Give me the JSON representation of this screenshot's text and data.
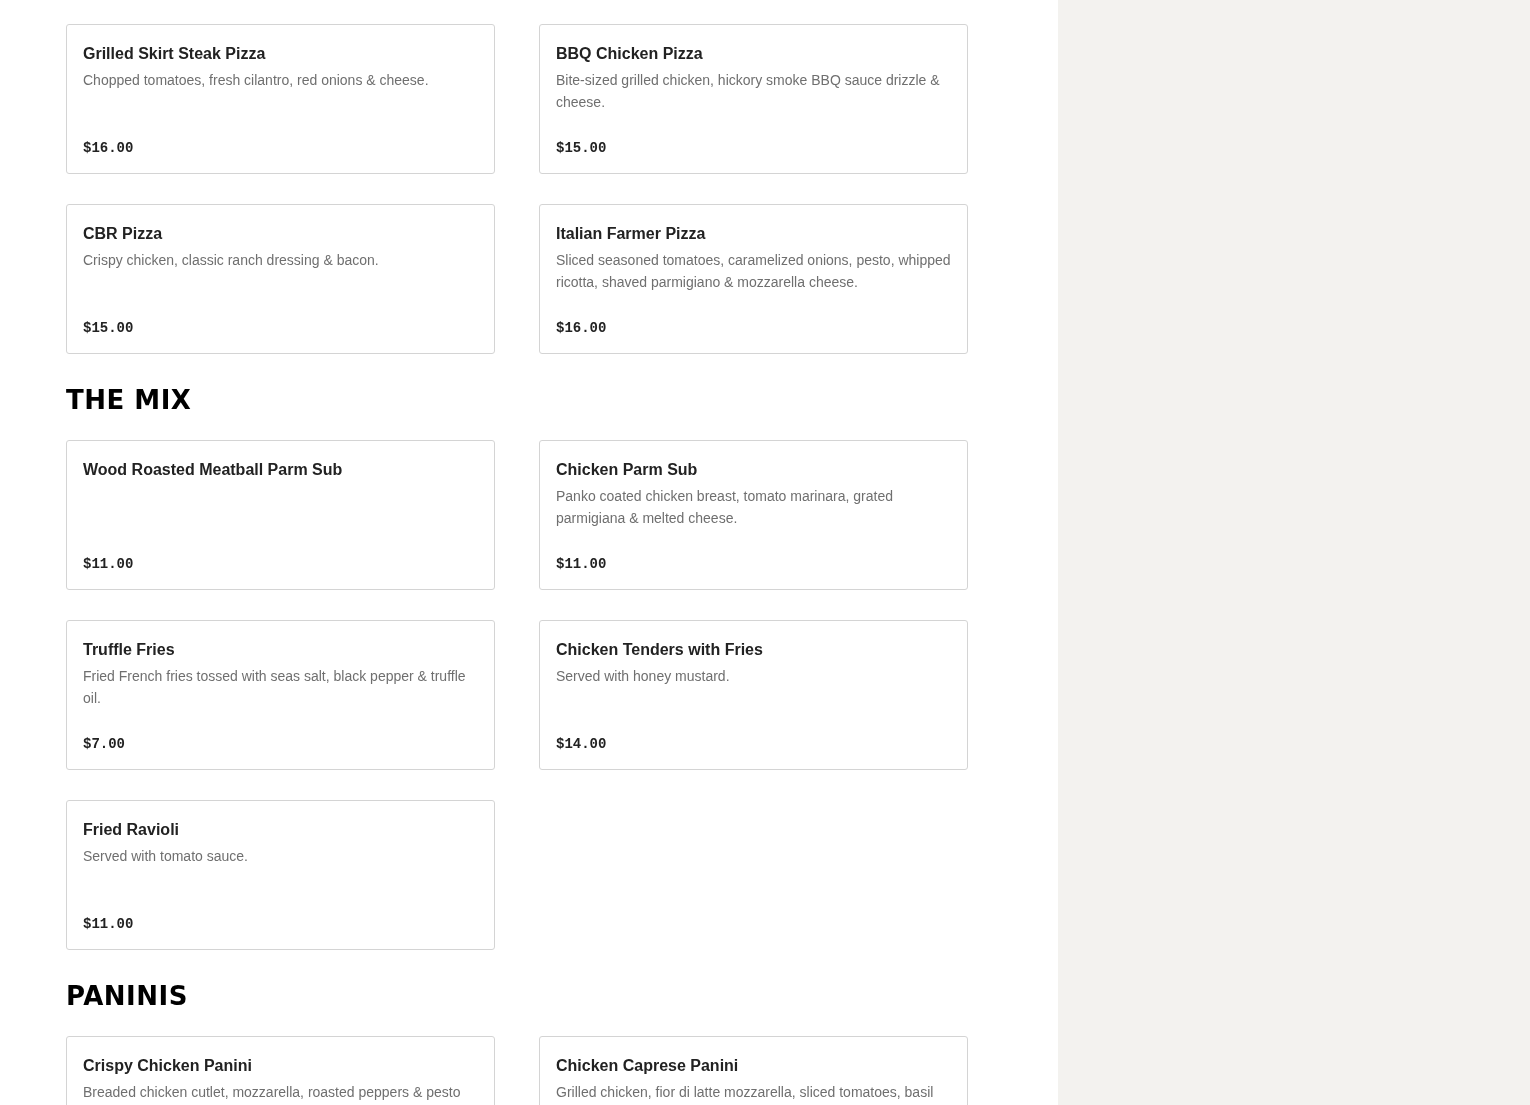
{
  "sections": [
    {
      "items": [
        {
          "name": "Grilled Skirt Steak Pizza",
          "description": "Chopped tomatoes, fresh cilantro, red onions & cheese.",
          "price": "$16.00"
        },
        {
          "name": "BBQ Chicken Pizza",
          "description": "Bite-sized grilled chicken, hickory smoke BBQ sauce drizzle & cheese.",
          "price": "$15.00"
        },
        {
          "name": "CBR Pizza",
          "description": "Crispy chicken, classic ranch dressing & bacon.",
          "price": "$15.00"
        },
        {
          "name": "Italian Farmer Pizza",
          "description": "Sliced seasoned tomatoes, caramelized onions, pesto, whipped ricotta, shaved parmigiano & mozzarella cheese.",
          "price": "$16.00"
        }
      ]
    },
    {
      "heading": "THE MIX",
      "items": [
        {
          "name": "Wood Roasted Meatball Parm Sub",
          "price": "$11.00"
        },
        {
          "name": "Chicken Parm Sub",
          "description": "Panko coated chicken breast, tomato marinara, grated parmigiana & melted cheese.",
          "price": "$11.00"
        },
        {
          "name": "Truffle Fries",
          "description": "Fried French fries tossed with seas salt, black pepper & truffle oil.",
          "price": "$7.00"
        },
        {
          "name": "Chicken Tenders with Fries",
          "description": "Served with honey mustard.",
          "price": "$14.00"
        },
        {
          "name": "Fried Ravioli",
          "description": "Served with tomato sauce.",
          "price": "$11.00"
        }
      ]
    },
    {
      "heading": "PANINIS",
      "items": [
        {
          "name": "Crispy Chicken Panini",
          "description": "Breaded chicken cutlet, mozzarella, roasted peppers & pesto"
        },
        {
          "name": "Chicken Caprese Panini",
          "description": "Grilled chicken, fior di latte mozzarella, sliced tomatoes, basil"
        }
      ]
    }
  ]
}
